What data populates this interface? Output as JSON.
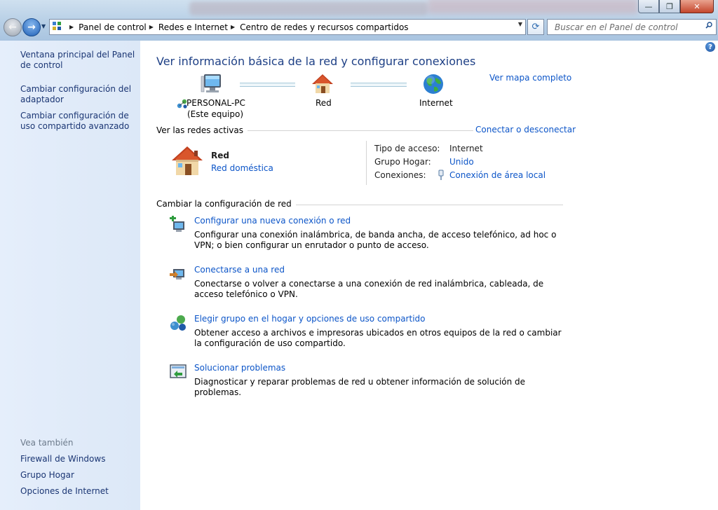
{
  "window": {
    "minimize": "—",
    "maximize": "❐",
    "close": "✕"
  },
  "nav": {
    "back": "←",
    "forward": "→",
    "history_dropdown": "▼"
  },
  "address": {
    "separator": "▶",
    "crumbs": [
      "Panel de control",
      "Redes e Internet",
      "Centro de redes y recursos compartidos"
    ],
    "dropdown": "▼",
    "refresh": "⟳"
  },
  "search": {
    "placeholder": "Buscar en el Panel de control"
  },
  "sidebar": {
    "items": [
      {
        "label": "Ventana principal del Panel de control"
      },
      {
        "label": "Cambiar configuración del adaptador"
      },
      {
        "label": "Cambiar configuración de uso compartido avanzado"
      }
    ],
    "see_also_title": "Vea también",
    "see_also": [
      {
        "label": "Firewall de Windows"
      },
      {
        "label": "Grupo Hogar"
      },
      {
        "label": "Opciones de Internet"
      }
    ]
  },
  "main": {
    "title": "Ver información básica de la red y configurar conexiones",
    "map_link": "Ver mapa completo",
    "help": "?",
    "map": {
      "computer": {
        "name": "PERSONAL-PC",
        "sub": "(Este equipo)",
        "icon": "computer-icon"
      },
      "network": {
        "name": "Red",
        "icon": "house-icon"
      },
      "internet": {
        "name": "Internet",
        "icon": "globe-icon"
      }
    },
    "active_networks": {
      "title": "Ver las redes activas",
      "connect_link": "Conectar o desconectar",
      "network_name": "Red",
      "network_type": "Red doméstica",
      "access_type_label": "Tipo de acceso:",
      "access_type_value": "Internet",
      "homegroup_label": "Grupo Hogar:",
      "homegroup_value": "Unido",
      "connections_label": "Conexiones:",
      "connections_value": "Conexión de área local"
    },
    "change_settings": {
      "title": "Cambiar la configuración de red",
      "tasks": [
        {
          "link": "Configurar una nueva conexión o red",
          "desc": "Configurar una conexión inalámbrica, de banda ancha, de acceso telefónico, ad hoc o VPN; o bien configurar un enrutador o punto de acceso."
        },
        {
          "link": "Conectarse a una red",
          "desc": "Conectarse o volver a conectarse a una conexión de red inalámbrica, cableada, de acceso telefónico o VPN."
        },
        {
          "link": "Elegir grupo en el hogar y opciones de uso compartido",
          "desc": "Obtener acceso a archivos e impresoras ubicados en otros equipos de la red o cambiar la configuración de uso compartido."
        },
        {
          "link": "Solucionar problemas",
          "desc": "Diagnosticar y reparar problemas de red u obtener información de solución de problemas."
        }
      ]
    }
  }
}
